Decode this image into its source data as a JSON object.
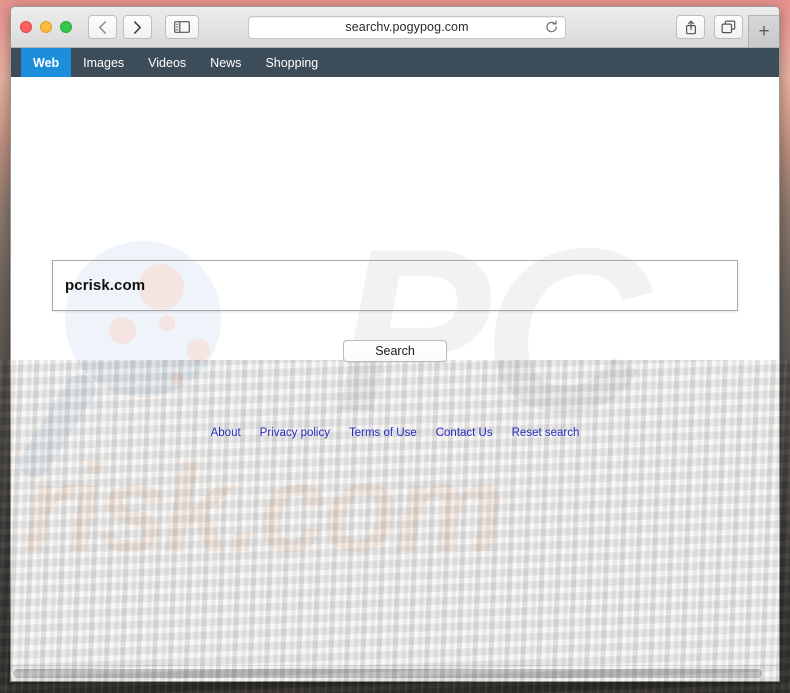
{
  "browser": {
    "window_controls": [
      {
        "name": "close",
        "color": "#fc615d"
      },
      {
        "name": "minimize",
        "color": "#fdbc40"
      },
      {
        "name": "zoom",
        "color": "#34c749"
      }
    ],
    "back_label": "‹",
    "forward_label": "›",
    "sidebar_icon": "sidebar-icon",
    "address_value": "searchv.pogypog.com",
    "address_placeholder": "Search or enter website name",
    "reload_icon": "reload-icon",
    "share_icon": "share-icon",
    "tabs_icon": "show-all-tabs-icon",
    "new_tab_label": "+"
  },
  "sitenav": {
    "items": [
      {
        "label": "Web",
        "active": true
      },
      {
        "label": "Images",
        "active": false
      },
      {
        "label": "Videos",
        "active": false
      },
      {
        "label": "News",
        "active": false
      },
      {
        "label": "Shopping",
        "active": false
      }
    ]
  },
  "search": {
    "query_value": "pcrisk.com",
    "query_placeholder": "",
    "button_label": "Search"
  },
  "watermark": {
    "logo_text": "PC",
    "domain_text": "risk.com",
    "logo_color": "#f2f2f2",
    "domain_color": "#fdf3ec",
    "magnifier_color": "#d6e4f0"
  },
  "footer": {
    "links": [
      {
        "label": "About"
      },
      {
        "label": "Privacy policy"
      },
      {
        "label": "Terms of Use"
      },
      {
        "label": "Contact Us"
      },
      {
        "label": "Reset search"
      }
    ],
    "link_color": "#2a2ac0"
  },
  "theme": {
    "nav_bg": "#3d4c59",
    "nav_active_bg": "#1b8ddb",
    "page_bg": "#ffffff"
  }
}
